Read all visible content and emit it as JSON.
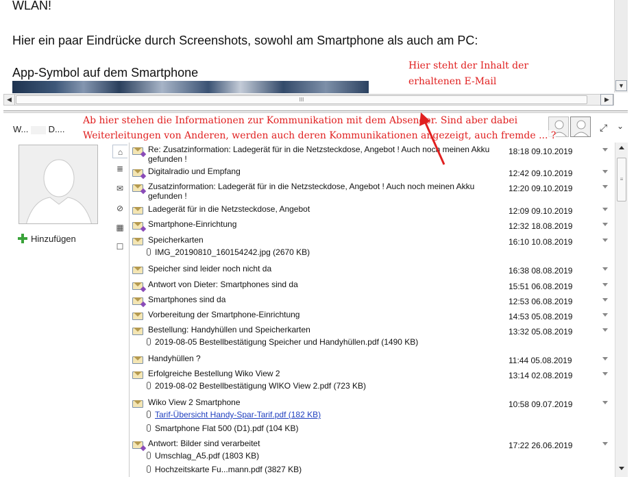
{
  "preview": {
    "line1": "WLAN!",
    "line2": "Hier ein paar Eindrücke durch Screenshots, sowohl am Smartphone als auch am PC:",
    "line3": "App-Symbol auf dem Smartphone",
    "hscroll_grip": "III"
  },
  "people_pane": {
    "contact_name_first": "W...",
    "contact_name_second": "D....",
    "add_label": "Hinzufügen",
    "list_scroll_grip": "≡"
  },
  "filter_tabs": [
    {
      "icon": "home-icon",
      "glyph": "⌂"
    },
    {
      "icon": "notes-icon",
      "glyph": "≣"
    },
    {
      "icon": "mail-icon",
      "glyph": "✉"
    },
    {
      "icon": "paperclip-icon",
      "glyph": "⊘"
    },
    {
      "icon": "calendar-icon",
      "glyph": "▦"
    },
    {
      "icon": "chat-icon",
      "glyph": "☐"
    }
  ],
  "messages": [
    {
      "subject": "Re: Zusatzinformation: Ladegerät für in die Netzsteckdose, Angebot ! Auch noch meinen Akku gefunden !",
      "time": "18:18 09.10.2019",
      "sent": true,
      "attachments": []
    },
    {
      "subject": "Digitalradio und Empfang",
      "time": "12:42 09.10.2019",
      "sent": true,
      "attachments": []
    },
    {
      "subject": "Zusatzinformation: Ladegerät für in die Netzsteckdose, Angebot ! Auch noch meinen Akku gefunden !",
      "time": "12:20 09.10.2019",
      "sent": true,
      "attachments": []
    },
    {
      "subject": "Ladegerät für in die Netzsteckdose, Angebot",
      "time": "12:09 09.10.2019",
      "sent": false,
      "attachments": []
    },
    {
      "subject": "Smartphone-Einrichtung",
      "time": "12:32 18.08.2019",
      "sent": true,
      "attachments": []
    },
    {
      "subject": "Speicherkarten",
      "time": "16:10 10.08.2019",
      "sent": false,
      "attachments": [
        {
          "name": "IMG_20190810_160154242.jpg (2670 KB)",
          "link": false
        }
      ]
    },
    {
      "subject": "Speicher sind leider noch nicht da",
      "time": "16:38 08.08.2019",
      "sent": false,
      "attachments": []
    },
    {
      "subject": "Antwort von Dieter: Smartphones sind da",
      "time": "15:51 06.08.2019",
      "sent": true,
      "attachments": []
    },
    {
      "subject": "Smartphones sind da",
      "time": "12:53 06.08.2019",
      "sent": true,
      "attachments": []
    },
    {
      "subject": "Vorbereitung der Smartphone-Einrichtung",
      "time": "14:53 05.08.2019",
      "sent": false,
      "attachments": []
    },
    {
      "subject": "Bestellung: Handyhüllen und Speicherkarten",
      "time": "13:32 05.08.2019",
      "sent": false,
      "attachments": [
        {
          "name": "2019-08-05 Bestellbestätigung Speicher und Handyhüllen.pdf (1490 KB)",
          "link": false
        }
      ]
    },
    {
      "subject": "Handyhüllen ?",
      "time": "11:44 05.08.2019",
      "sent": false,
      "attachments": []
    },
    {
      "subject": "Erfolgreiche Bestellung Wiko View 2",
      "time": "13:14 02.08.2019",
      "sent": false,
      "attachments": [
        {
          "name": "2019-08-02 Bestellbestätigung WIKO View 2.pdf (723 KB)",
          "link": false
        }
      ]
    },
    {
      "subject": "Wiko View 2 Smartphone",
      "time": "10:58 09.07.2019",
      "sent": false,
      "attachments": [
        {
          "name": "Tarif-Übersicht Handy-Spar-Tarif.pdf (182 KB)",
          "link": true
        },
        {
          "name": "Smartphone Flat 500 (D1).pdf (104 KB)",
          "link": false
        }
      ]
    },
    {
      "subject": "Antwort: Bilder sind verarbeitet",
      "time": "17:22 26.06.2019",
      "sent": true,
      "attachments": [
        {
          "name": "Umschlag_A5.pdf (1803 KB)",
          "link": false
        },
        {
          "name": "Hochzeitskarte Fu...mann.pdf (3827 KB)",
          "link": false
        }
      ]
    }
  ],
  "annotations": {
    "a1": "Hier steht der Inhalt der",
    "a2": "erhaltenen E-Mail",
    "a3": "Ab hier stehen die Informationen zur Kommunikation mit dem      Absender. Sind aber dabei",
    "a4": "Weiterleitungen von Anderen, werden auch deren Kommunikationen angezeigt, auch fremde ... ?",
    "color": "#e02020"
  }
}
